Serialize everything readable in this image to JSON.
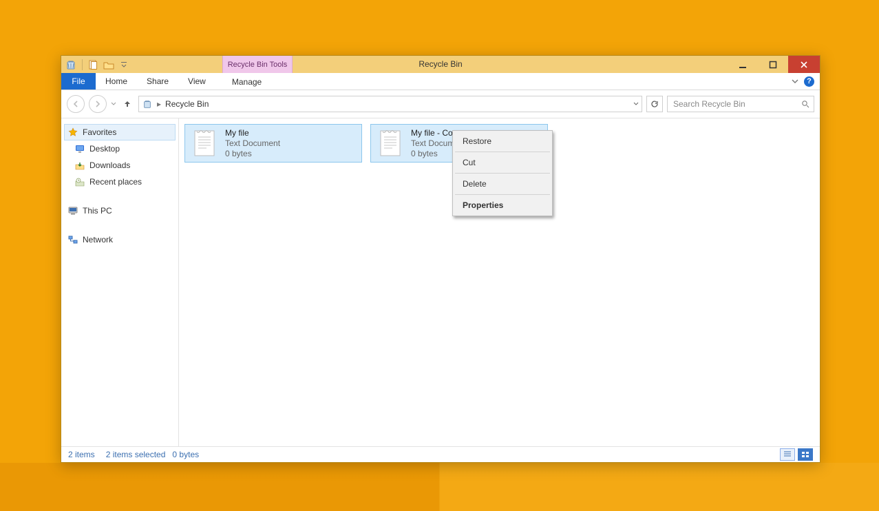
{
  "window": {
    "title": "Recycle Bin",
    "contextualTab": "Recycle Bin Tools"
  },
  "ribbon": {
    "file": "File",
    "tabs": [
      "Home",
      "Share",
      "View"
    ],
    "manage": "Manage"
  },
  "address": {
    "location": "Recycle Bin"
  },
  "search": {
    "placeholder": "Search Recycle Bin"
  },
  "sidebar": {
    "favorites": {
      "header": "Favorites",
      "items": [
        "Desktop",
        "Downloads",
        "Recent places"
      ]
    },
    "thispc": "This PC",
    "network": "Network"
  },
  "files": [
    {
      "name": "My file",
      "type": "Text Document",
      "size": "0 bytes"
    },
    {
      "name": "My file - Copy",
      "type": "Text Document",
      "size": "0 bytes"
    }
  ],
  "contextMenu": {
    "restore": "Restore",
    "cut": "Cut",
    "delete": "Delete",
    "properties": "Properties"
  },
  "status": {
    "count": "2 items",
    "selection": "2 items selected",
    "size": "0 bytes"
  }
}
